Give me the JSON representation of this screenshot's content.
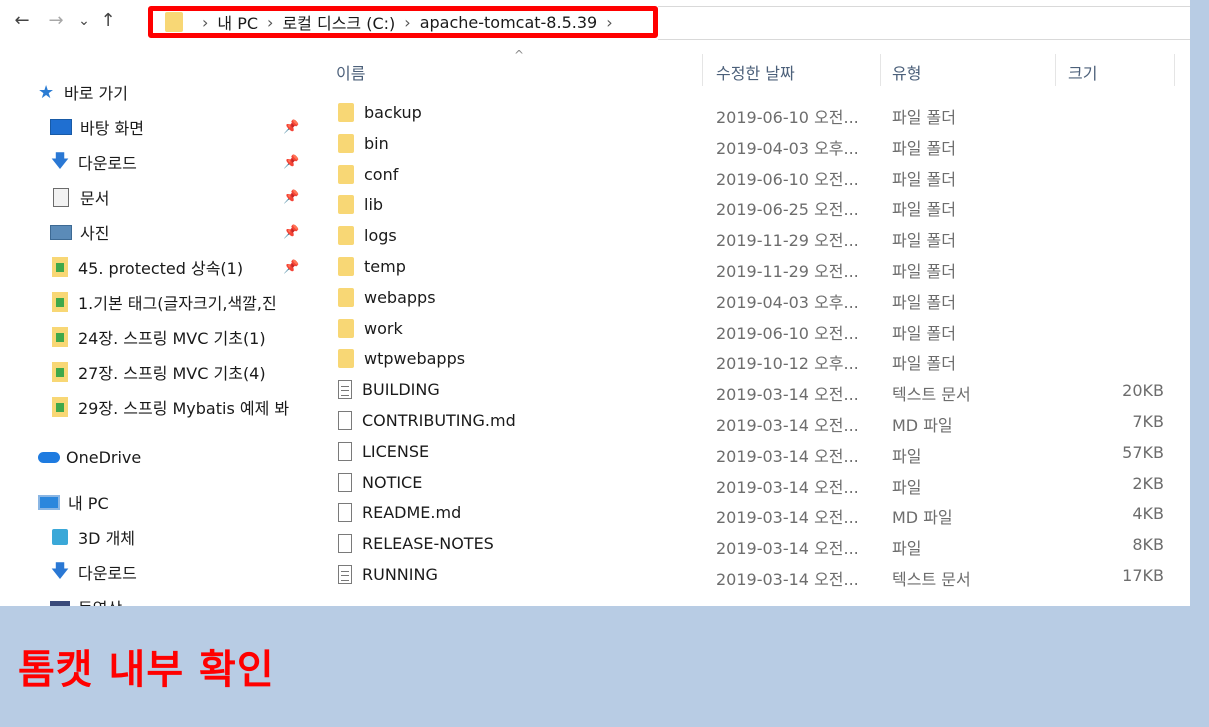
{
  "nav": {
    "back": "←",
    "forward": "→",
    "recent": "⌄",
    "up": "↑"
  },
  "breadcrumb": [
    "내 PC",
    "로컬 디스크 (C:)",
    "apache-tomcat-8.5.39"
  ],
  "sidebar": {
    "quick_access": "바로 가기",
    "items": [
      {
        "label": "바탕 화면",
        "icon": "desktop-icon",
        "pinned": true
      },
      {
        "label": "다운로드",
        "icon": "download-icon",
        "pinned": true
      },
      {
        "label": "문서",
        "icon": "document-icon",
        "pinned": true
      },
      {
        "label": "사진",
        "icon": "pictures-icon",
        "pinned": true
      },
      {
        "label": "45. protected 상속(1)",
        "icon": "folder-icon",
        "pinned": true
      },
      {
        "label": "1.기본 태그(글자크기,색깔,진",
        "icon": "folder-icon",
        "pinned": false
      },
      {
        "label": "24장. 스프링 MVC 기초(1)",
        "icon": "folder-icon",
        "pinned": false
      },
      {
        "label": "27장. 스프링 MVC 기초(4)",
        "icon": "folder-icon",
        "pinned": false
      },
      {
        "label": "29장. 스프링 Mybatis 예제 봐",
        "icon": "folder-icon",
        "pinned": false
      }
    ],
    "onedrive": "OneDrive",
    "this_pc": "내 PC",
    "pc_items": [
      {
        "label": "3D 개체",
        "icon": "3d-objects-icon"
      },
      {
        "label": "다운로드",
        "icon": "download-icon"
      },
      {
        "label": "동영상",
        "icon": "video-icon"
      }
    ]
  },
  "columns": {
    "name": "이름",
    "date": "수정한 날짜",
    "type": "유형",
    "size": "크기"
  },
  "files": [
    {
      "name": "backup",
      "date": "2019-06-10 오전...",
      "type": "파일 폴더",
      "size": "",
      "kind": "folder"
    },
    {
      "name": "bin",
      "date": "2019-04-03 오후...",
      "type": "파일 폴더",
      "size": "",
      "kind": "folder"
    },
    {
      "name": "conf",
      "date": "2019-06-10 오전...",
      "type": "파일 폴더",
      "size": "",
      "kind": "folder"
    },
    {
      "name": "lib",
      "date": "2019-06-25 오전...",
      "type": "파일 폴더",
      "size": "",
      "kind": "folder"
    },
    {
      "name": "logs",
      "date": "2019-11-29 오전...",
      "type": "파일 폴더",
      "size": "",
      "kind": "folder"
    },
    {
      "name": "temp",
      "date": "2019-11-29 오전...",
      "type": "파일 폴더",
      "size": "",
      "kind": "folder"
    },
    {
      "name": "webapps",
      "date": "2019-04-03 오후...",
      "type": "파일 폴더",
      "size": "",
      "kind": "folder"
    },
    {
      "name": "work",
      "date": "2019-06-10 오전...",
      "type": "파일 폴더",
      "size": "",
      "kind": "folder"
    },
    {
      "name": "wtpwebapps",
      "date": "2019-10-12 오후...",
      "type": "파일 폴더",
      "size": "",
      "kind": "folder"
    },
    {
      "name": "BUILDING",
      "date": "2019-03-14 오전...",
      "type": "텍스트 문서",
      "size": "20KB",
      "kind": "text"
    },
    {
      "name": "CONTRIBUTING.md",
      "date": "2019-03-14 오전...",
      "type": "MD 파일",
      "size": "7KB",
      "kind": "file"
    },
    {
      "name": "LICENSE",
      "date": "2019-03-14 오전...",
      "type": "파일",
      "size": "57KB",
      "kind": "file"
    },
    {
      "name": "NOTICE",
      "date": "2019-03-14 오전...",
      "type": "파일",
      "size": "2KB",
      "kind": "file"
    },
    {
      "name": "README.md",
      "date": "2019-03-14 오전...",
      "type": "MD 파일",
      "size": "4KB",
      "kind": "file"
    },
    {
      "name": "RELEASE-NOTES",
      "date": "2019-03-14 오전...",
      "type": "파일",
      "size": "8KB",
      "kind": "file"
    },
    {
      "name": "RUNNING",
      "date": "2019-03-14 오전...",
      "type": "텍스트 문서",
      "size": "17KB",
      "kind": "text"
    }
  ],
  "caption": "톰캣 내부 확인",
  "colors": {
    "highlight_border": "#ff0000",
    "caption": "#ff0000",
    "background": "#b8cce4",
    "folder": "#f8d775"
  }
}
